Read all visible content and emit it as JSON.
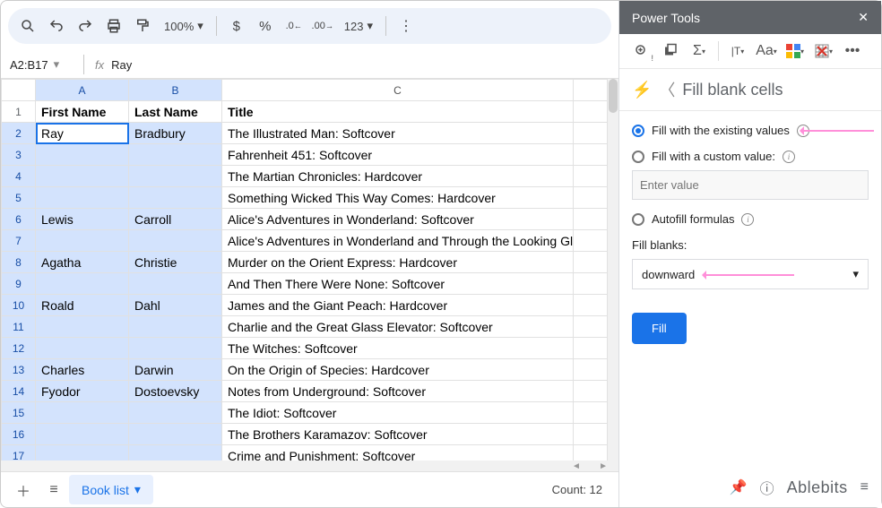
{
  "toolbar": {
    "zoom": "100%",
    "num_preview": "123"
  },
  "formula_bar": {
    "range": "A2:B17",
    "value": "Ray"
  },
  "columns": [
    "A",
    "B",
    "C"
  ],
  "headers": {
    "first": "First Name",
    "last": "Last Name",
    "title": "Title"
  },
  "rows": [
    {
      "n": 1,
      "first": "First Name",
      "last": "Last Name",
      "title": "Title",
      "hdr": true
    },
    {
      "n": 2,
      "first": "Ray",
      "last": "Bradbury",
      "title": "The Illustrated Man: Softcover",
      "active": true
    },
    {
      "n": 3,
      "first": "",
      "last": "",
      "title": "Fahrenheit 451: Softcover"
    },
    {
      "n": 4,
      "first": "",
      "last": "",
      "title": "The Martian Chronicles: Hardcover"
    },
    {
      "n": 5,
      "first": "",
      "last": "",
      "title": "Something Wicked This Way Comes: Hardcover"
    },
    {
      "n": 6,
      "first": "Lewis",
      "last": "Carroll",
      "title": "Alice's Adventures in Wonderland: Softcover"
    },
    {
      "n": 7,
      "first": "",
      "last": "",
      "title": "Alice's Adventures in Wonderland and Through the Looking Glass: Hardcover"
    },
    {
      "n": 8,
      "first": "Agatha",
      "last": "Christie",
      "title": "Murder on the Orient Express: Hardcover"
    },
    {
      "n": 9,
      "first": "",
      "last": "",
      "title": "And Then There Were None: Softcover"
    },
    {
      "n": 10,
      "first": "Roald",
      "last": "Dahl",
      "title": "James and the Giant Peach: Hardcover"
    },
    {
      "n": 11,
      "first": "",
      "last": "",
      "title": "Charlie and the Great Glass Elevator: Softcover"
    },
    {
      "n": 12,
      "first": "",
      "last": "",
      "title": "The Witches: Softcover"
    },
    {
      "n": 13,
      "first": "Charles",
      "last": "Darwin",
      "title": "On the Origin of Species: Hardcover"
    },
    {
      "n": 14,
      "first": "Fyodor",
      "last": "Dostoevsky",
      "title": "Notes from Underground: Softcover"
    },
    {
      "n": 15,
      "first": "",
      "last": "",
      "title": "The Idiot: Softcover"
    },
    {
      "n": 16,
      "first": "",
      "last": "",
      "title": "The Brothers Karamazov: Softcover"
    },
    {
      "n": 17,
      "first": "",
      "last": "",
      "title": "Crime and Punishment: Softcover"
    }
  ],
  "sheet_tab": "Book list",
  "count_label": "Count: 12",
  "panel": {
    "title": "Power Tools",
    "section": "Fill blank cells",
    "opt_existing": "Fill with the existing values",
    "opt_custom": "Fill with a custom value:",
    "custom_placeholder": "Enter value",
    "opt_autofill": "Autofill formulas",
    "direction_label": "Fill blanks:",
    "direction_value": "downward",
    "fill_btn": "Fill",
    "brand": "Ablebits"
  }
}
